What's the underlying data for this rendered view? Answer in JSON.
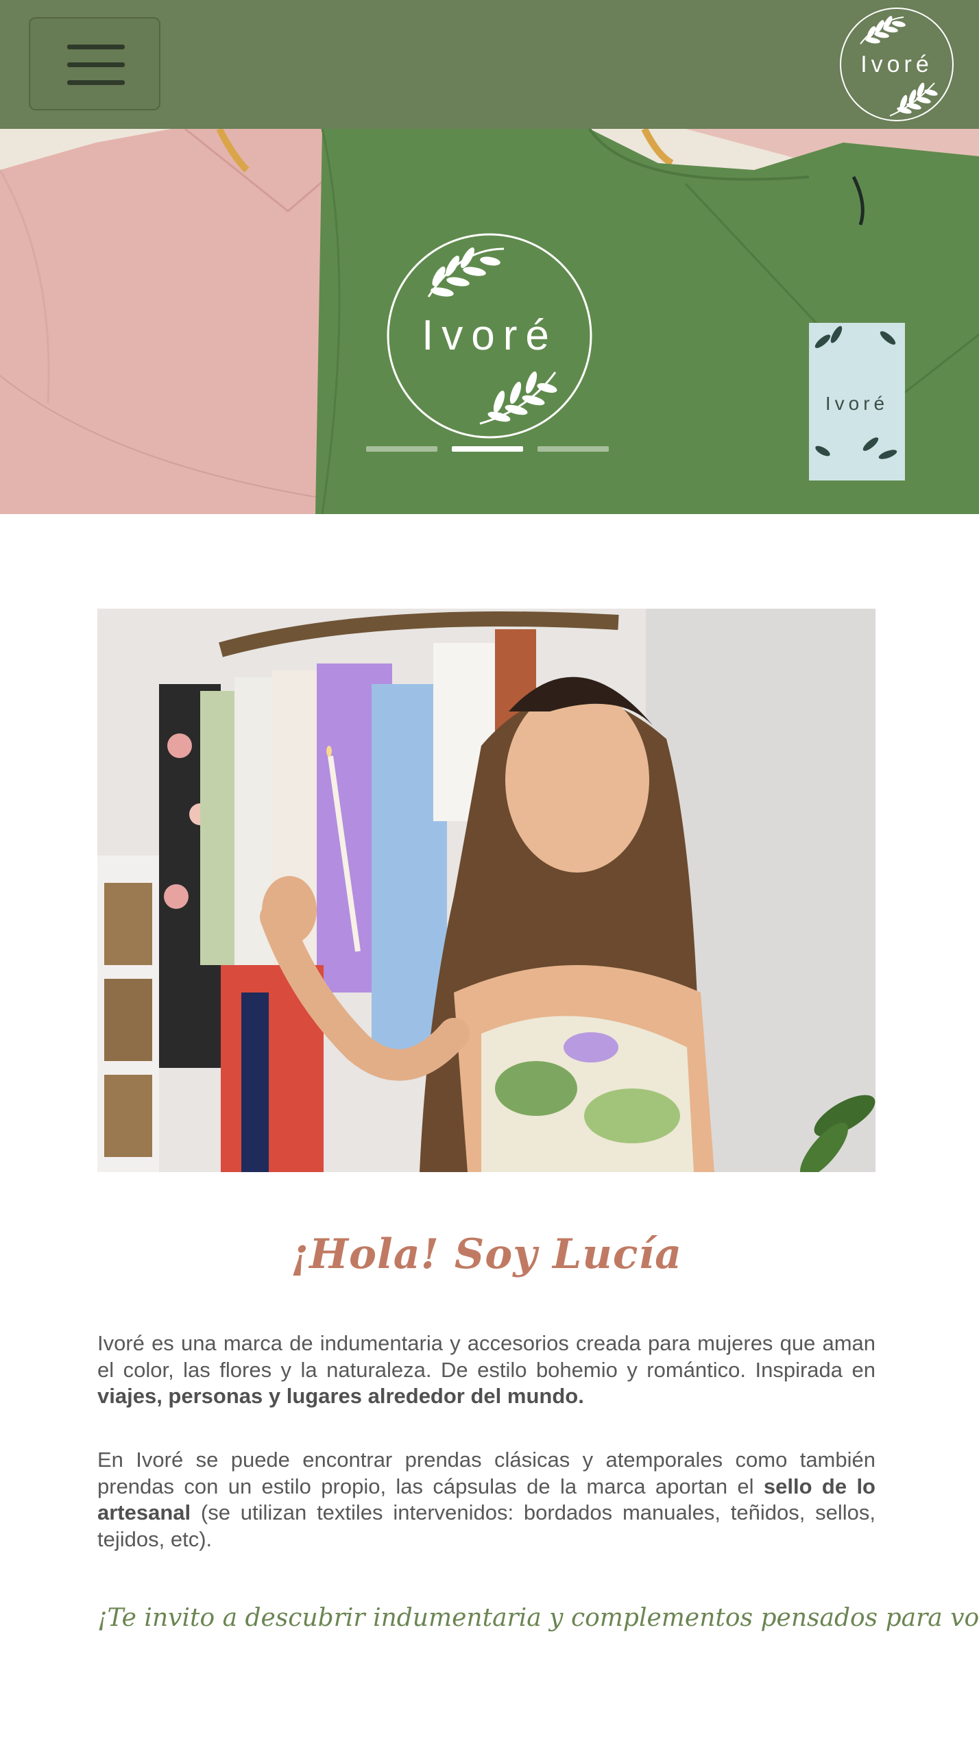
{
  "brand": {
    "name": "Ivoré"
  },
  "header": {
    "menu_label": "menu"
  },
  "hero": {
    "tag_text": "Ivoré",
    "slide_count": 3,
    "active_slide": 2
  },
  "about": {
    "heading": "¡Hola! Soy Lucía",
    "p1_a": "Ivoré es una marca de indumentaria y accesorios creada para mujeres que aman el color, las flores y la naturaleza. De estilo bohemio y romántico. Inspirada en ",
    "p1_b": "viajes, personas y lugares alrededor del mundo.",
    "p2_a": "En Ivoré se puede encontrar prendas clásicas y atemporales como también prendas con un estilo propio, las cápsulas de la marca aportan el ",
    "p2_b": "sello de lo artesanal",
    "p2_c": " (se utilizan textiles intervenidos: bordados manuales, teñidos, sellos, tejidos, etc).",
    "closing": "¡Te invito a descubrir indumentaria y complementos pensados para vos!"
  },
  "colors": {
    "header_bg": "#6b7f58",
    "heading": "#c07a63",
    "closing": "#6b8552"
  }
}
